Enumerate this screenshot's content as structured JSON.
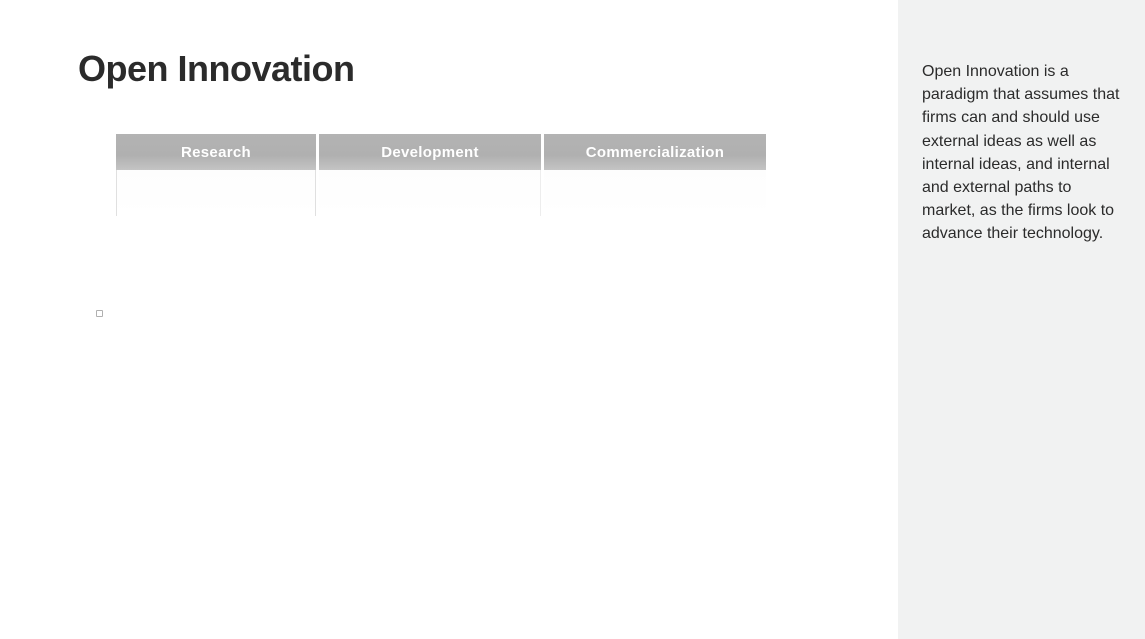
{
  "slide": {
    "title": "Open Innovation"
  },
  "diagram": {
    "stages": [
      {
        "label": "Research"
      },
      {
        "label": "Development"
      },
      {
        "label": "Commercialization"
      }
    ]
  },
  "sidebar": {
    "description": "Open Innovation is a paradigm that assumes that firms can and should use external ideas as well as internal ideas, and internal and external paths to market, as the firms look to advance their technology."
  }
}
